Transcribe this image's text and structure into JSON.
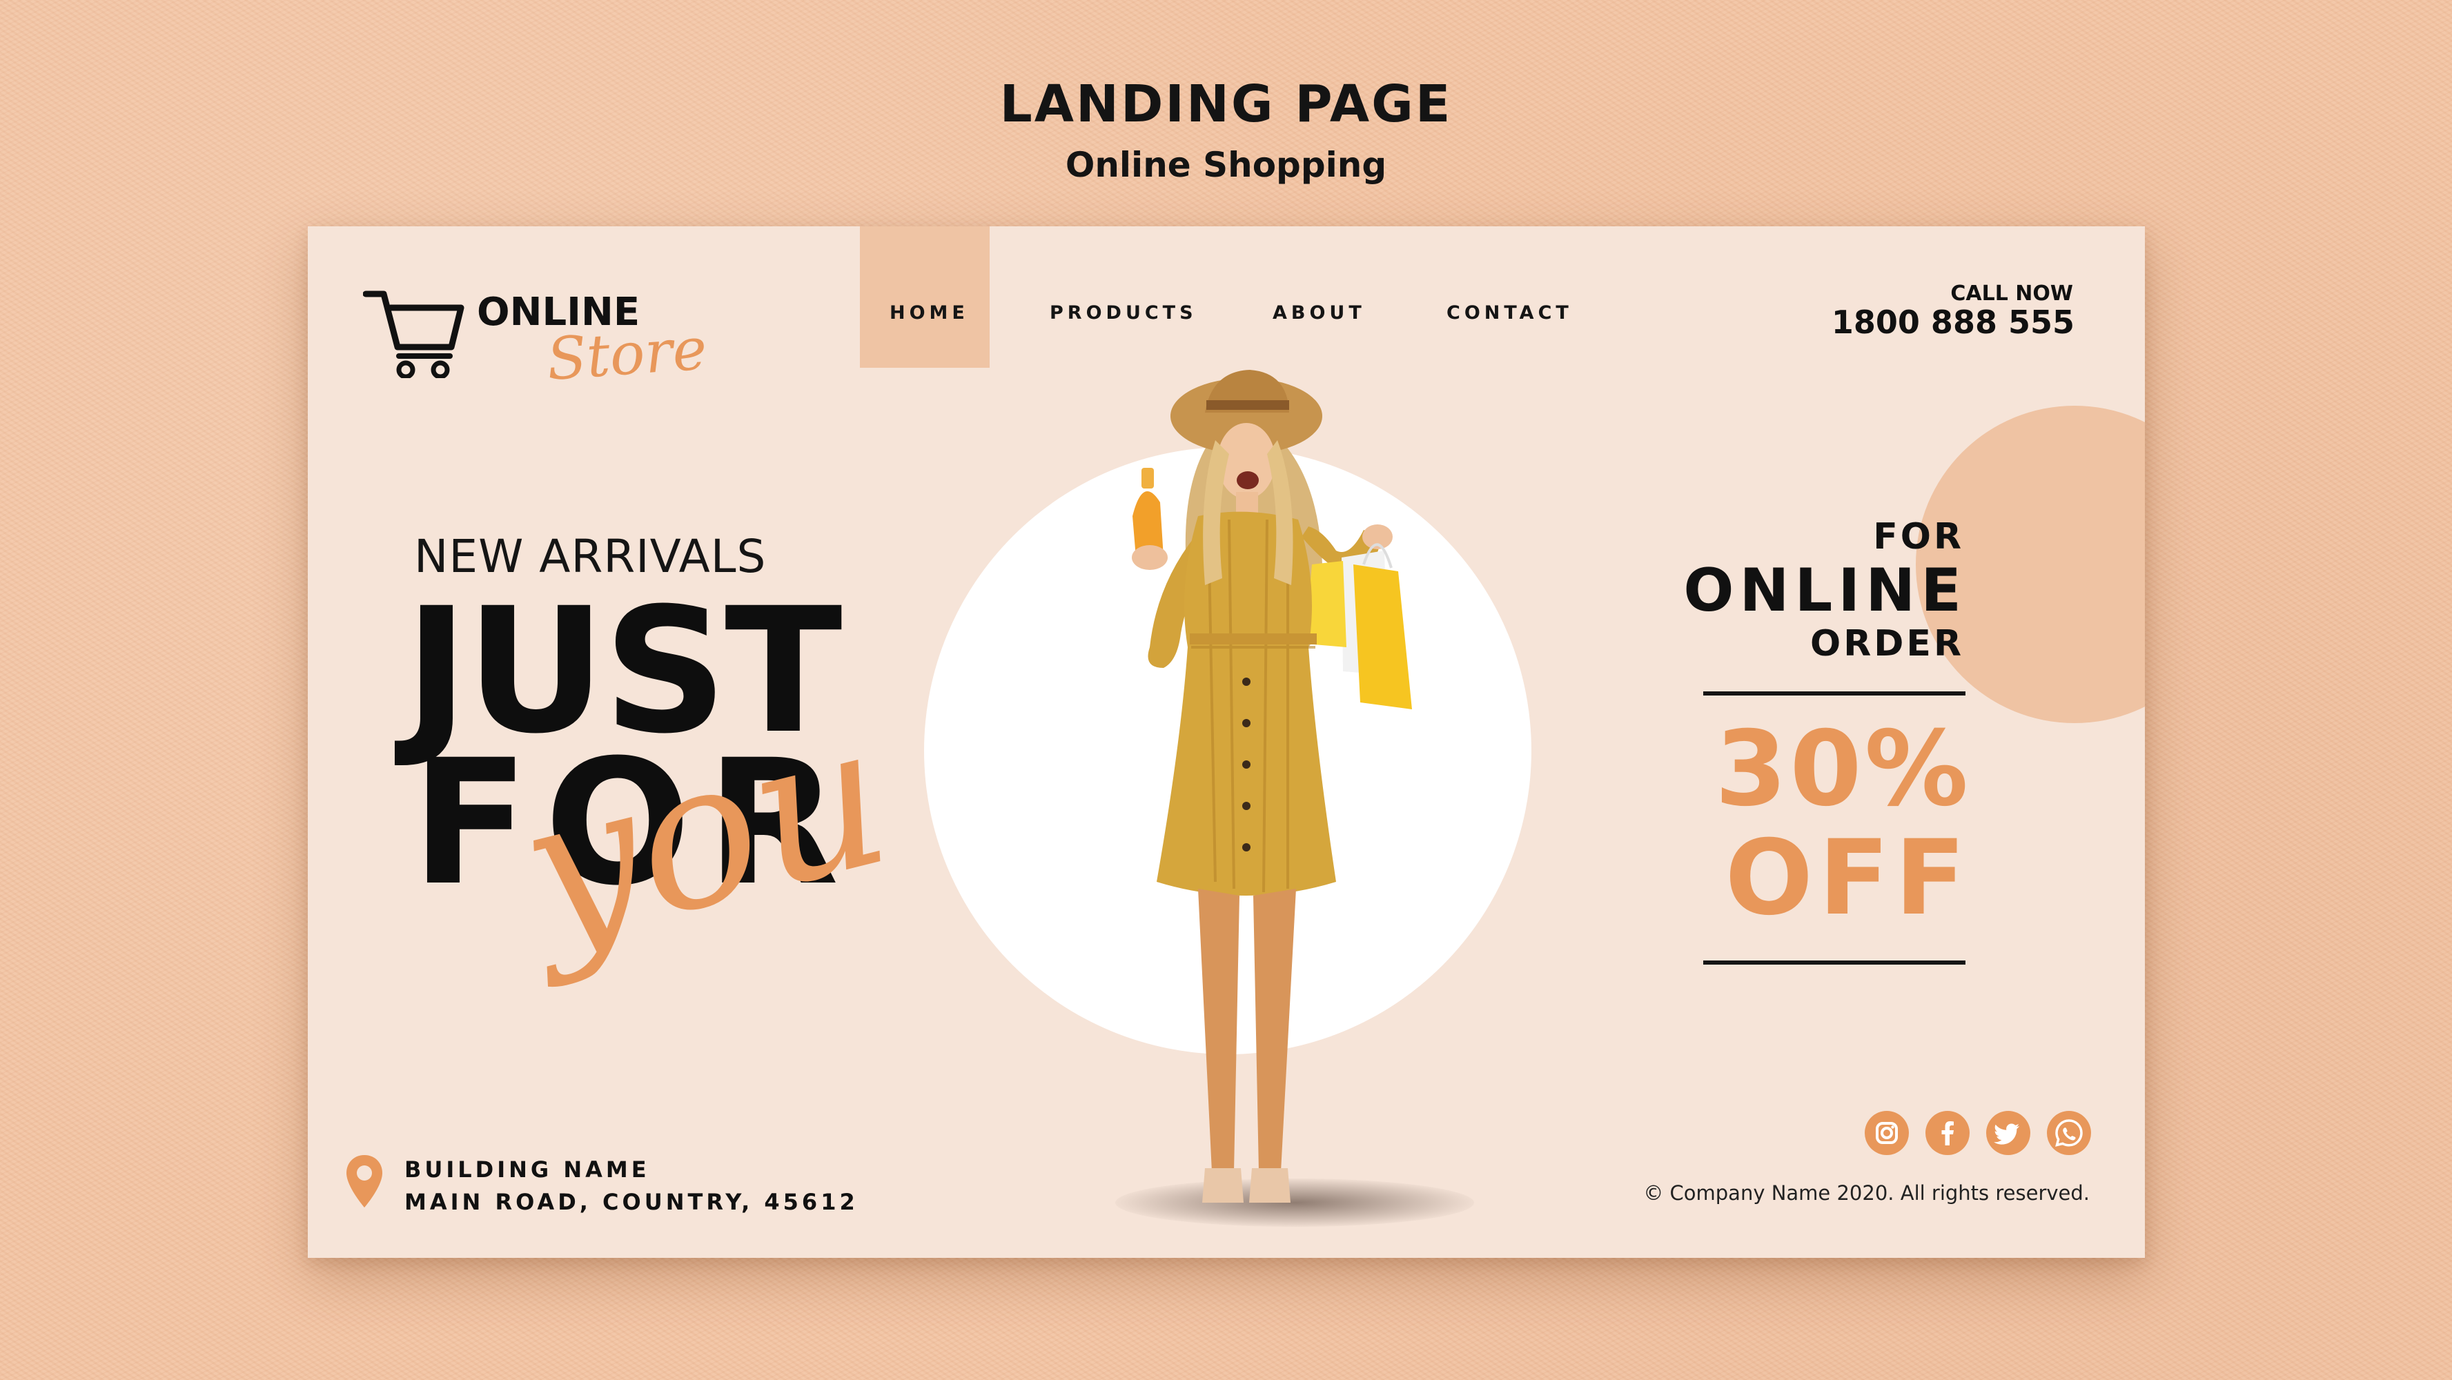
{
  "frame": {
    "title": "LANDING PAGE",
    "subtitle": "Online Shopping"
  },
  "logo": {
    "icon": "shopping-cart-icon",
    "line1": "ONLINE",
    "line2": "Store"
  },
  "nav": {
    "items": [
      {
        "label": "HOME",
        "active": true
      },
      {
        "label": "PRODUCTS",
        "active": false
      },
      {
        "label": "ABOUT",
        "active": false
      },
      {
        "label": "CONTACT",
        "active": false
      }
    ]
  },
  "contact": {
    "label": "CALL NOW",
    "phone": "1800 888 555"
  },
  "hero": {
    "kicker": "NEW ARRIVALS",
    "line1": "JUST",
    "line2": "FOR",
    "script": "you"
  },
  "promo": {
    "line1": "FOR",
    "line2": "ONLINE",
    "line3": "ORDER",
    "discount": "30%",
    "off": "OFF"
  },
  "address": {
    "icon": "location-pin-icon",
    "line1": "BUILDING NAME",
    "line2": "MAIN ROAD, COUNTRY, 45612"
  },
  "social": [
    "instagram-icon",
    "facebook-icon",
    "twitter-icon",
    "whatsapp-icon"
  ],
  "footer": {
    "copyright": "© Company Name 2020. All rights reserved."
  },
  "colors": {
    "background": "#f3c4a3",
    "card": "#f6e4d8",
    "accent": "#e8975a",
    "nav_active_bg": "#efc4a4",
    "text": "#111111"
  }
}
